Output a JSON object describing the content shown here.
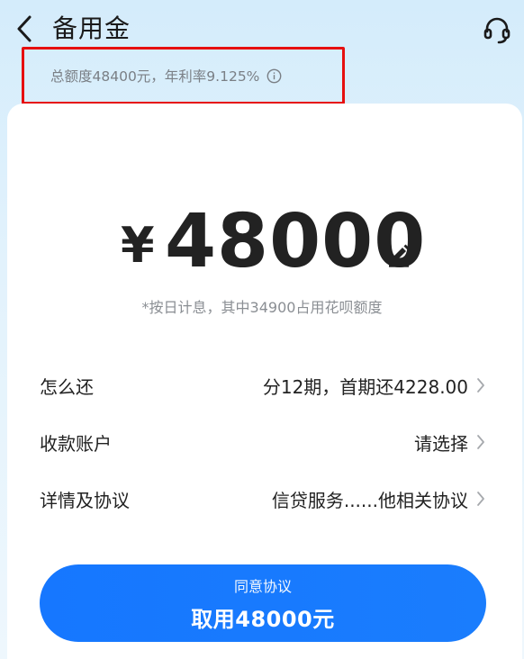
{
  "header": {
    "title": "备用金",
    "back_icon": "chevron-left-icon",
    "service_icon": "headset-icon"
  },
  "summary": {
    "text": "总额度48400元，年利率9.125%",
    "info_icon": "info-icon"
  },
  "amount": {
    "currency": "¥",
    "value": "48000",
    "edit_icon": "pencil-icon",
    "note": "*按日计息，其中34900占用花呗额度"
  },
  "rows": [
    {
      "label": "怎么还",
      "value": "分12期，首期还4228.00"
    },
    {
      "label": "收款账户",
      "value": "请选择"
    },
    {
      "label": "详情及协议",
      "value": "信贷服务......他相关协议"
    }
  ],
  "confirm": {
    "top_label": "同意协议",
    "main_label": "取用48000元"
  },
  "colors": {
    "accent": "#1677ff",
    "highlight_border": "#e60f0f",
    "background": "#d4ecfb"
  }
}
